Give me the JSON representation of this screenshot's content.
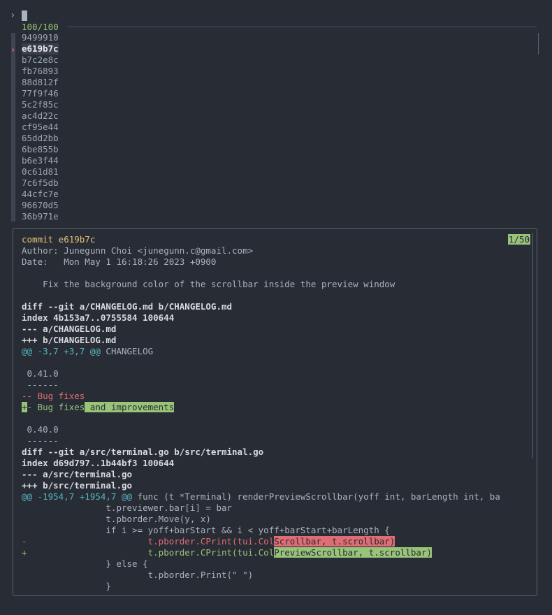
{
  "prompt": {
    "symbol": "›",
    "query": ""
  },
  "status": {
    "count": "100/100"
  },
  "list": {
    "items": [
      "9499910",
      "e619b7c",
      "b7c2e8c",
      "fb76893",
      "88d812f",
      "77f9f46",
      "5c2f85c",
      "ac4d22c",
      "cf95e44",
      "65dd2bb",
      "6be855b",
      "b6e3f44",
      "0c61d81",
      "7c6f5db",
      "44cfc7e",
      "96670d5",
      "36b971e"
    ],
    "selected_index": 1,
    "pointer": "›"
  },
  "preview": {
    "position": "1/50",
    "commit_line": "commit e619b7c",
    "author_line": "Author: Junegunn Choi <junegunn.c@gmail.com>",
    "date_line": "Date:   Mon May 1 16:18:26 2023 +0900",
    "message_line": "    Fix the background color of the scrollbar inside the preview window",
    "diff1_header": "diff --git a/CHANGELOG.md b/CHANGELOG.md",
    "diff1_index": "index 4b153a7..0755584 100644",
    "diff1_minus": "--- a/CHANGELOG.md",
    "diff1_plus": "+++ b/CHANGELOG.md",
    "hunk1_range": "@@ -3,7 +3,7 @@",
    "hunk1_context": " CHANGELOG",
    "ctx1": " 0.41.0",
    "ctx2": " ------",
    "del1": "-- Bug fixes",
    "add1_marker": "+",
    "add1_text": "- Bug fixes",
    "add1_hl": " and improvements",
    "ctx3": " 0.40.0",
    "ctx4": " ------",
    "diff2_header": "diff --git a/src/terminal.go b/src/terminal.go",
    "diff2_index": "index d69d797..1b44bf3 100644",
    "diff2_minus": "--- a/src/terminal.go",
    "diff2_plus": "+++ b/src/terminal.go",
    "hunk2_range": "@@ -1954,7 +1954,7 @@",
    "hunk2_context": " func (t *Terminal) renderPreviewScrollbar(yoff int, barLength int, ba",
    "code1": "                t.previewer.bar[i] = bar",
    "code2": "                t.pborder.Move(y, x)",
    "code3": "                if i >= yoff+barStart && i < yoff+barStart+barLength {",
    "del2_text": "-                       t.pborder.CPrint(tui.Col",
    "del2_hl": "Scrollbar, t.scrollbar)",
    "add2_text": "+                       t.pborder.CPrint(tui.Col",
    "add2_hl": "PreviewScrollbar, t.scrollbar)",
    "code4": "                } else {",
    "code5": "                        t.pborder.Print(\" \")",
    "code6": "                }"
  },
  "colors": {
    "background": "#282c34",
    "accent_green": "#98c379",
    "accent_red": "#e06c75",
    "accent_yellow": "#e5c07b",
    "accent_cyan": "#56b6c2"
  }
}
